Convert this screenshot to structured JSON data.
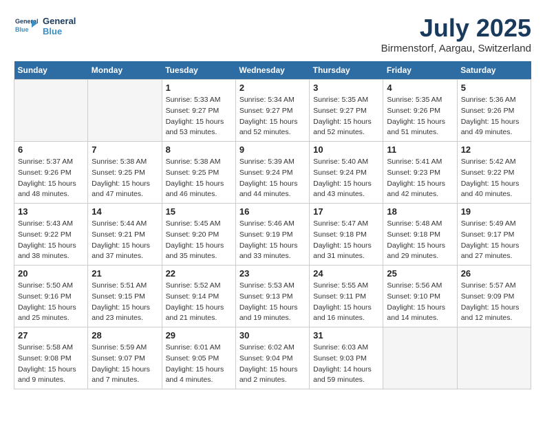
{
  "header": {
    "logo_line1": "General",
    "logo_line2": "Blue",
    "month_title": "July 2025",
    "location": "Birmenstorf, Aargau, Switzerland"
  },
  "weekdays": [
    "Sunday",
    "Monday",
    "Tuesday",
    "Wednesday",
    "Thursday",
    "Friday",
    "Saturday"
  ],
  "weeks": [
    [
      {
        "day": "",
        "empty": true
      },
      {
        "day": "",
        "empty": true
      },
      {
        "day": "1",
        "sunrise": "5:33 AM",
        "sunset": "9:27 PM",
        "daylight": "15 hours and 53 minutes."
      },
      {
        "day": "2",
        "sunrise": "5:34 AM",
        "sunset": "9:27 PM",
        "daylight": "15 hours and 52 minutes."
      },
      {
        "day": "3",
        "sunrise": "5:35 AM",
        "sunset": "9:27 PM",
        "daylight": "15 hours and 52 minutes."
      },
      {
        "day": "4",
        "sunrise": "5:35 AM",
        "sunset": "9:26 PM",
        "daylight": "15 hours and 51 minutes."
      },
      {
        "day": "5",
        "sunrise": "5:36 AM",
        "sunset": "9:26 PM",
        "daylight": "15 hours and 49 minutes."
      }
    ],
    [
      {
        "day": "6",
        "sunrise": "5:37 AM",
        "sunset": "9:26 PM",
        "daylight": "15 hours and 48 minutes."
      },
      {
        "day": "7",
        "sunrise": "5:38 AM",
        "sunset": "9:25 PM",
        "daylight": "15 hours and 47 minutes."
      },
      {
        "day": "8",
        "sunrise": "5:38 AM",
        "sunset": "9:25 PM",
        "daylight": "15 hours and 46 minutes."
      },
      {
        "day": "9",
        "sunrise": "5:39 AM",
        "sunset": "9:24 PM",
        "daylight": "15 hours and 44 minutes."
      },
      {
        "day": "10",
        "sunrise": "5:40 AM",
        "sunset": "9:24 PM",
        "daylight": "15 hours and 43 minutes."
      },
      {
        "day": "11",
        "sunrise": "5:41 AM",
        "sunset": "9:23 PM",
        "daylight": "15 hours and 42 minutes."
      },
      {
        "day": "12",
        "sunrise": "5:42 AM",
        "sunset": "9:22 PM",
        "daylight": "15 hours and 40 minutes."
      }
    ],
    [
      {
        "day": "13",
        "sunrise": "5:43 AM",
        "sunset": "9:22 PM",
        "daylight": "15 hours and 38 minutes."
      },
      {
        "day": "14",
        "sunrise": "5:44 AM",
        "sunset": "9:21 PM",
        "daylight": "15 hours and 37 minutes."
      },
      {
        "day": "15",
        "sunrise": "5:45 AM",
        "sunset": "9:20 PM",
        "daylight": "15 hours and 35 minutes."
      },
      {
        "day": "16",
        "sunrise": "5:46 AM",
        "sunset": "9:19 PM",
        "daylight": "15 hours and 33 minutes."
      },
      {
        "day": "17",
        "sunrise": "5:47 AM",
        "sunset": "9:18 PM",
        "daylight": "15 hours and 31 minutes."
      },
      {
        "day": "18",
        "sunrise": "5:48 AM",
        "sunset": "9:18 PM",
        "daylight": "15 hours and 29 minutes."
      },
      {
        "day": "19",
        "sunrise": "5:49 AM",
        "sunset": "9:17 PM",
        "daylight": "15 hours and 27 minutes."
      }
    ],
    [
      {
        "day": "20",
        "sunrise": "5:50 AM",
        "sunset": "9:16 PM",
        "daylight": "15 hours and 25 minutes."
      },
      {
        "day": "21",
        "sunrise": "5:51 AM",
        "sunset": "9:15 PM",
        "daylight": "15 hours and 23 minutes."
      },
      {
        "day": "22",
        "sunrise": "5:52 AM",
        "sunset": "9:14 PM",
        "daylight": "15 hours and 21 minutes."
      },
      {
        "day": "23",
        "sunrise": "5:53 AM",
        "sunset": "9:13 PM",
        "daylight": "15 hours and 19 minutes."
      },
      {
        "day": "24",
        "sunrise": "5:55 AM",
        "sunset": "9:11 PM",
        "daylight": "15 hours and 16 minutes."
      },
      {
        "day": "25",
        "sunrise": "5:56 AM",
        "sunset": "9:10 PM",
        "daylight": "15 hours and 14 minutes."
      },
      {
        "day": "26",
        "sunrise": "5:57 AM",
        "sunset": "9:09 PM",
        "daylight": "15 hours and 12 minutes."
      }
    ],
    [
      {
        "day": "27",
        "sunrise": "5:58 AM",
        "sunset": "9:08 PM",
        "daylight": "15 hours and 9 minutes."
      },
      {
        "day": "28",
        "sunrise": "5:59 AM",
        "sunset": "9:07 PM",
        "daylight": "15 hours and 7 minutes."
      },
      {
        "day": "29",
        "sunrise": "6:01 AM",
        "sunset": "9:05 PM",
        "daylight": "15 hours and 4 minutes."
      },
      {
        "day": "30",
        "sunrise": "6:02 AM",
        "sunset": "9:04 PM",
        "daylight": "15 hours and 2 minutes."
      },
      {
        "day": "31",
        "sunrise": "6:03 AM",
        "sunset": "9:03 PM",
        "daylight": "14 hours and 59 minutes."
      },
      {
        "day": "",
        "empty": true
      },
      {
        "day": "",
        "empty": true
      }
    ]
  ]
}
